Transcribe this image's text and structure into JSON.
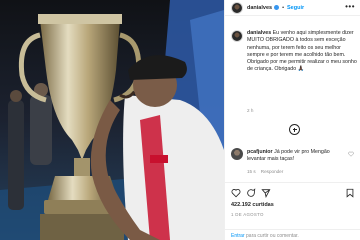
{
  "post": {
    "username": "danialves",
    "separator": "•",
    "follow_label": "Seguir",
    "more_label": "•••"
  },
  "caption": {
    "username": "danialves",
    "text": "Eu venho aqui simplesmente dizer MUITO OBRIGADO à todos sem exceção nenhuma, por terem feito os seu melhor sempre e por terem me acolhido tão bem. Obrigado por me permitir realizar o meu sonho de criança. Obrigado 🙏🏿",
    "time": "2 h"
  },
  "comment": {
    "username": "pcafjunior",
    "text": "Já pode vir pro Mengão levantar mais taças!",
    "time": "15 s",
    "reply_label": "Responder"
  },
  "stats": {
    "likes": "422.192 curtidas",
    "date": "1 DE AGOSTO"
  },
  "footer": {
    "link": "Entrar",
    "text": "para curtir ou comentar."
  },
  "colors": {
    "accent": "#0095f6",
    "verified": "#3897f0",
    "muted": "#8e8e8e"
  }
}
